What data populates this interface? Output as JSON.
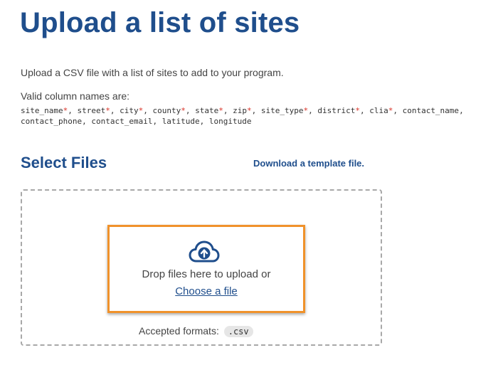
{
  "page": {
    "title": "Upload a list of sites",
    "intro": "Upload a CSV file with a list of sites to add to your program.",
    "valid_label": "Valid column names are:"
  },
  "columns": [
    {
      "name": "site_name",
      "required": true
    },
    {
      "name": "street",
      "required": true
    },
    {
      "name": "city",
      "required": true
    },
    {
      "name": "county",
      "required": true
    },
    {
      "name": "state",
      "required": true
    },
    {
      "name": "zip",
      "required": true
    },
    {
      "name": "site_type",
      "required": true
    },
    {
      "name": "district",
      "required": true
    },
    {
      "name": "clia",
      "required": true
    },
    {
      "name": "contact_name",
      "required": false
    },
    {
      "name": "contact_phone",
      "required": false
    },
    {
      "name": "contact_email",
      "required": false
    },
    {
      "name": "latitude",
      "required": false
    },
    {
      "name": "longitude",
      "required": false
    }
  ],
  "required_marker": "*",
  "separator": ", ",
  "upload": {
    "section_title": "Select Files",
    "template_link": "Download a template file.",
    "drop_text": "Drop files here to upload or",
    "choose_label": "Choose a file",
    "accepted_label": "Accepted formats:",
    "formats": [
      ".csv"
    ],
    "icon": "cloud-upload-icon"
  },
  "colors": {
    "heading": "#1f4e8c",
    "required": "#d93025",
    "highlight": "#f0922b"
  }
}
